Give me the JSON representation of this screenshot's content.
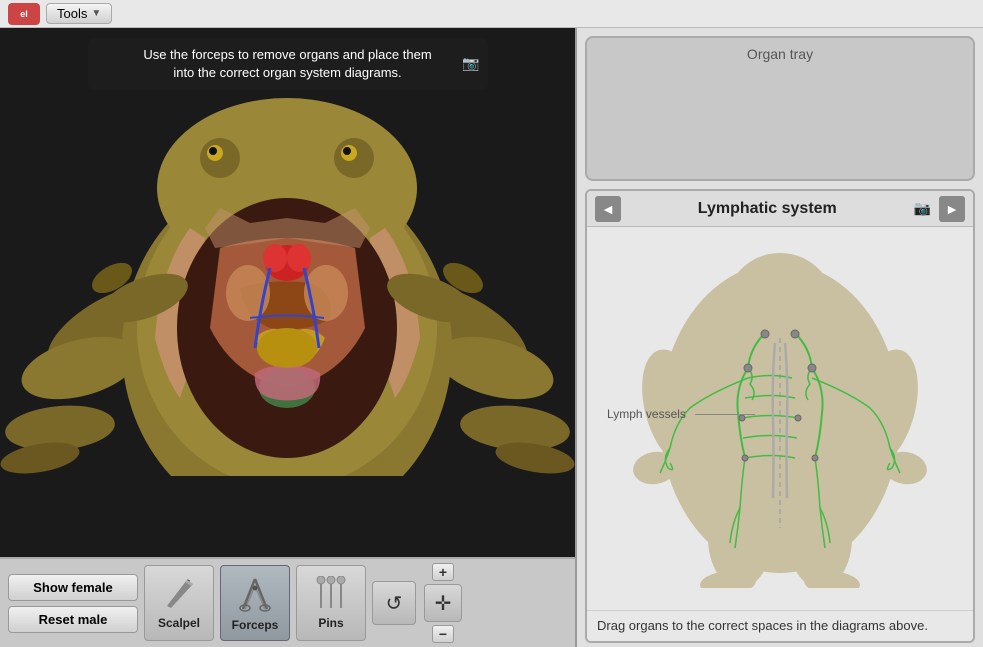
{
  "topbar": {
    "logo_text": "el",
    "tools_label": "Tools"
  },
  "tooltip": {
    "text": "Use the forceps to remove organs and place them\ninto the correct organ system diagrams."
  },
  "organ_tray": {
    "label": "Organ tray"
  },
  "system": {
    "title": "Lymphatic system",
    "left_arrow": "◄",
    "right_arrow": "►",
    "lymph_vessels_label": "Lymph vessels"
  },
  "instructions": {
    "text": "Drag organs to the correct spaces in the\ndiagrams above."
  },
  "toolbar": {
    "show_female_label": "Show female",
    "reset_male_label": "Reset male",
    "scalpel_label": "Scalpel",
    "forceps_label": "Forceps",
    "pins_label": "Pins"
  },
  "zoom": {
    "plus": "+",
    "minus": "−"
  }
}
